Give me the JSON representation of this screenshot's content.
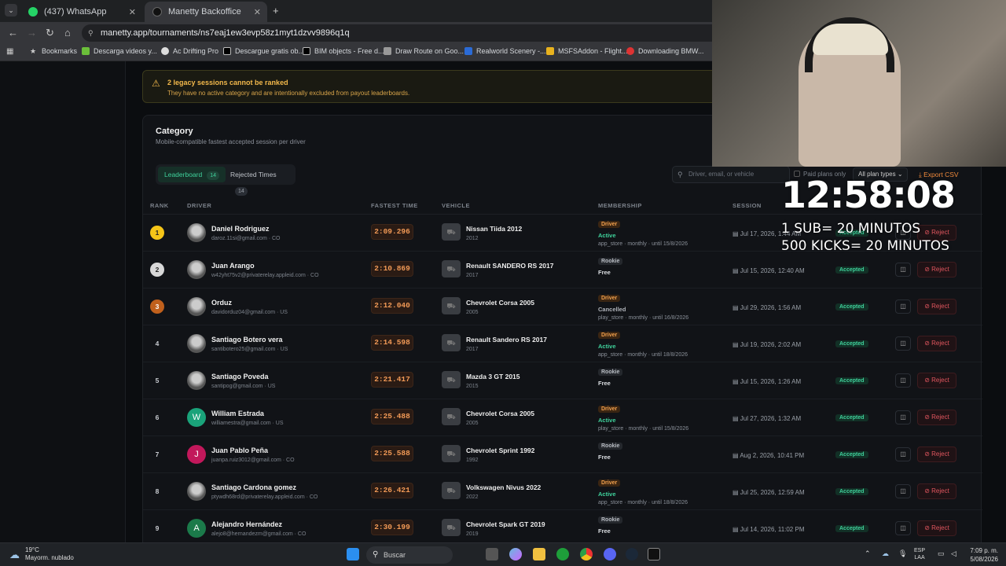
{
  "browser": {
    "tabs": [
      {
        "label": "(437) WhatsApp"
      },
      {
        "label": "Manetty Backoffice"
      }
    ],
    "url": "manetty.app/tournaments/ns7eaj1ew3evp58z1myt1dzvv9896q1q",
    "bookmarks": [
      "Bookmarks",
      "Descarga videos y...",
      "Ac Drifting Pro",
      "Descargue gratis ob...",
      "BIM objects - Free d...",
      "Draw Route on Goo...",
      "Realworld Scenery -...",
      "MSFSAddon - Flight...",
      "Downloading BMW..."
    ]
  },
  "warning": {
    "title": "2 legacy sessions cannot be ranked",
    "text": "They have no active category and are intentionally excluded from payout leaderboards."
  },
  "card": {
    "title": "Category",
    "subtitle": "Mobile-compatible fastest accepted session per driver",
    "tabs": [
      {
        "label": "Leaderboard",
        "count": "14"
      },
      {
        "label": "Rejected Times",
        "count": "14"
      }
    ],
    "search_placeholder": "Driver, email, or vehicle",
    "paid_only": "Paid plans only",
    "plan_select": "All plan types",
    "export": "Export CSV",
    "columns": [
      "RANK",
      "DRIVER",
      "FASTEST TIME",
      "VEHICLE",
      "MEMBERSHIP",
      "SESSION"
    ]
  },
  "rows": [
    {
      "rank": "1",
      "name": "Daniel Rodriguez",
      "email": "daroz.11si@gmail.com · CO",
      "time": "2:09.296",
      "vehicle": "Nissan Tiida 2012",
      "year": "2012",
      "tier": "Driver",
      "status": "Active",
      "detail": "app_store · monthly · until 15/8/2026",
      "session": "Jul 17, 2026, 1:44 AM",
      "accepted": "Accepted",
      "reject": "Reject",
      "avatar": ""
    },
    {
      "rank": "2",
      "name": "Juan Arango",
      "email": "w42yht75v2@privaterelay.appleid.com · CO",
      "time": "2:10.869",
      "vehicle": "Renault SANDERO RS 2017",
      "year": "2017",
      "tier": "Rookie",
      "status": "Free",
      "detail": "",
      "session": "Jul 15, 2026, 12:40 AM",
      "accepted": "Accepted",
      "reject": "Reject",
      "avatar": ""
    },
    {
      "rank": "3",
      "name": "Orduz",
      "email": "davidorduz04@gmail.com · US",
      "time": "2:12.040",
      "vehicle": "Chevrolet Corsa 2005",
      "year": "2005",
      "tier": "Driver",
      "status": "Cancelled",
      "detail": "play_store · monthly · until 16/8/2026",
      "session": "Jul 29, 2026, 1:56 AM",
      "accepted": "Accepted",
      "reject": "Reject",
      "avatar": ""
    },
    {
      "rank": "4",
      "name": "Santiago Botero vera",
      "email": "santibotero25@gmail.com · US",
      "time": "2:14.598",
      "vehicle": "Renault Sandero RS 2017",
      "year": "2017",
      "tier": "Driver",
      "status": "Active",
      "detail": "app_store · monthly · until 18/8/2026",
      "session": "Jul 19, 2026, 2:02 AM",
      "accepted": "Accepted",
      "reject": "Reject",
      "avatar": ""
    },
    {
      "rank": "5",
      "name": "Santiago Poveda",
      "email": "santipog@gmail.com · US",
      "time": "2:21.417",
      "vehicle": "Mazda 3 GT 2015",
      "year": "2015",
      "tier": "Rookie",
      "status": "Free",
      "detail": "",
      "session": "Jul 15, 2026, 1:26 AM",
      "accepted": "Accepted",
      "reject": "Reject",
      "avatar": ""
    },
    {
      "rank": "6",
      "name": "William Estrada",
      "email": "williamestra@gmail.com · US",
      "time": "2:25.488",
      "vehicle": "Chevrolet Corsa 2005",
      "year": "2005",
      "tier": "Driver",
      "status": "Active",
      "detail": "play_store · monthly · until 15/8/2026",
      "session": "Jul 27, 2026, 1:32 AM",
      "accepted": "Accepted",
      "reject": "Reject",
      "avatar": "W"
    },
    {
      "rank": "7",
      "name": "Juan Pablo Peña",
      "email": "juanpa.ruiz3012@gmail.com · CO",
      "time": "2:25.588",
      "vehicle": "Chevrolet Sprint 1992",
      "year": "1992",
      "tier": "Rookie",
      "status": "Free",
      "detail": "",
      "session": "Aug 2, 2026, 10:41 PM",
      "accepted": "Accepted",
      "reject": "Reject",
      "avatar": "J"
    },
    {
      "rank": "8",
      "name": "Santiago Cardona gomez",
      "email": "ptywdh68rd@privaterelay.appleid.com · CO",
      "time": "2:26.421",
      "vehicle": "Volkswagen Nivus 2022",
      "year": "2022",
      "tier": "Driver",
      "status": "Active",
      "detail": "app_store · monthly · until 18/8/2026",
      "session": "Jul 25, 2026, 12:59 AM",
      "accepted": "Accepted",
      "reject": "Reject",
      "avatar": ""
    },
    {
      "rank": "9",
      "name": "Alejandro Hernández",
      "email": "alejo8@hernandezm@gmail.com · CO",
      "time": "2:30.199",
      "vehicle": "Chevrolet Spark GT 2019",
      "year": "2019",
      "tier": "Rookie",
      "status": "Free",
      "detail": "",
      "session": "Jul 14, 2026, 11:02 PM",
      "accepted": "Accepted",
      "reject": "Reject",
      "avatar": "A"
    }
  ],
  "overlay": {
    "timer": "12:58:08",
    "line1": "1 SUB= 20 MINUTOS",
    "line2": "500 KICKS= 20 MINUTOS"
  },
  "taskbar": {
    "temp": "19°C",
    "weather": "Mayorm. nublado",
    "search": "Buscar",
    "lang1": "ESP",
    "lang2": "LAA",
    "time": "7:09 p. m.",
    "date": "5/08/2026"
  }
}
